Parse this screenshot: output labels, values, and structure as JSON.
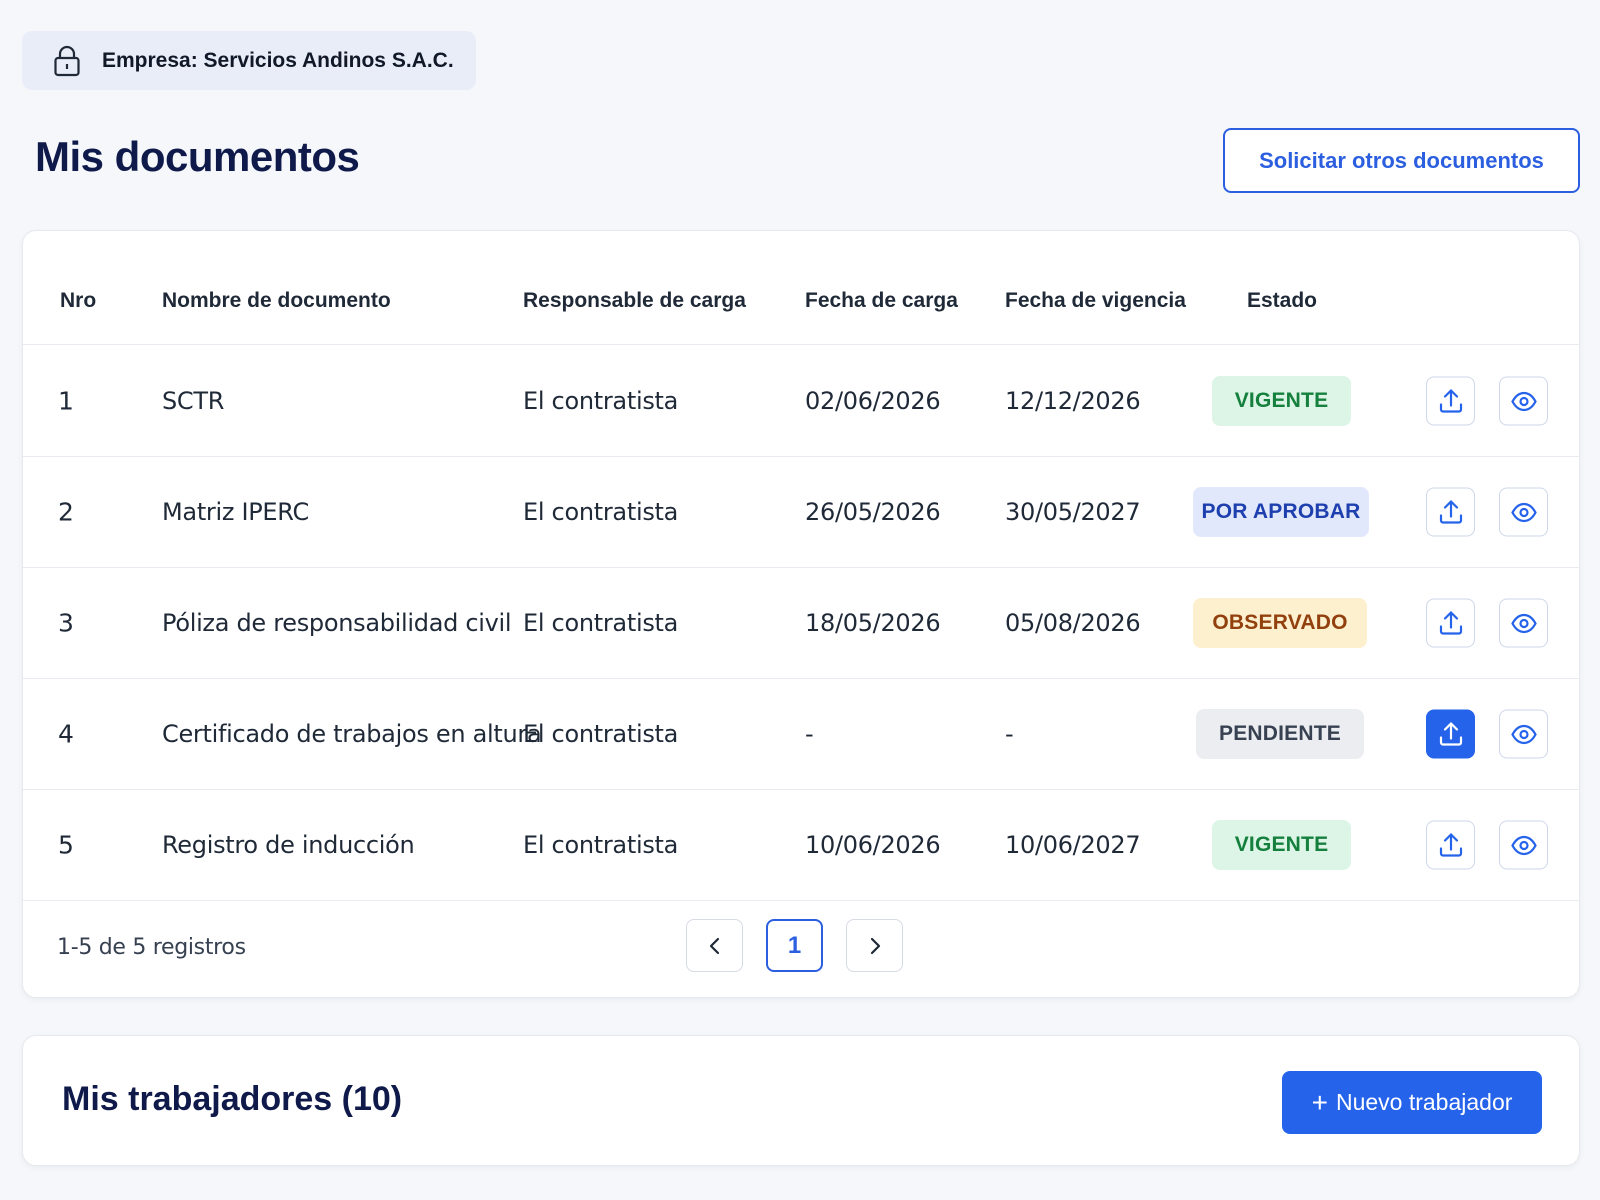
{
  "company": {
    "label": "Empresa: Servicios Andinos S.A.C.",
    "icon": "lock-icon"
  },
  "header": {
    "title": "Mis documentos",
    "request_button": "Solicitar otros documentos"
  },
  "table": {
    "columns": [
      "Nro",
      "Nombre de documento",
      "Responsable de carga",
      "Fecha de carga",
      "Fecha de vigencia",
      "Estado"
    ],
    "rows": [
      {
        "nro": "1",
        "nombre": "SCTR",
        "responsable": "El contratista",
        "fecha_carga": "02/06/2026",
        "fecha_vigencia": "12/12/2026",
        "estado": "VIGENTE"
      },
      {
        "nro": "2",
        "nombre": "Matriz IPERC",
        "responsable": "El contratista",
        "fecha_carga": "26/05/2026",
        "fecha_vigencia": "30/05/2027",
        "estado": "POR APROBAR"
      },
      {
        "nro": "3",
        "nombre": "Póliza de responsabilidad civil",
        "responsable": "El contratista",
        "fecha_carga": "18/05/2026",
        "fecha_vigencia": "05/08/2026",
        "estado": "OBSERVADO"
      },
      {
        "nro": "4",
        "nombre": "Certificado de trabajos en altura",
        "responsable": "El contratista",
        "fecha_carga": "-",
        "fecha_vigencia": "-",
        "estado": "PENDIENTE"
      },
      {
        "nro": "5",
        "nombre": "Registro de inducción",
        "responsable": "El contratista",
        "fecha_carga": "10/06/2026",
        "fecha_vigencia": "10/06/2027",
        "estado": "VIGENTE"
      }
    ],
    "status_colors": {
      "VIGENTE": {
        "bg": "#dcf5e6",
        "fg": "#15803d"
      },
      "POR APROBAR": {
        "bg": "#e2e8fb",
        "fg": "#1e40af"
      },
      "OBSERVADO": {
        "bg": "#fdf0cf",
        "fg": "#92400e"
      },
      "PENDIENTE": {
        "bg": "#ebedf0",
        "fg": "#374151"
      }
    }
  },
  "pagination": {
    "summary": "1-5 de 5 registros",
    "current_page": "1"
  },
  "workers": {
    "title": "Mis trabajadores (10)",
    "new_button": "Nuevo trabajador",
    "new_button_icon": "plus-icon"
  },
  "colors": {
    "accent": "#2563eb",
    "title": "#0f1a4a",
    "background": "#f5f7fa"
  }
}
